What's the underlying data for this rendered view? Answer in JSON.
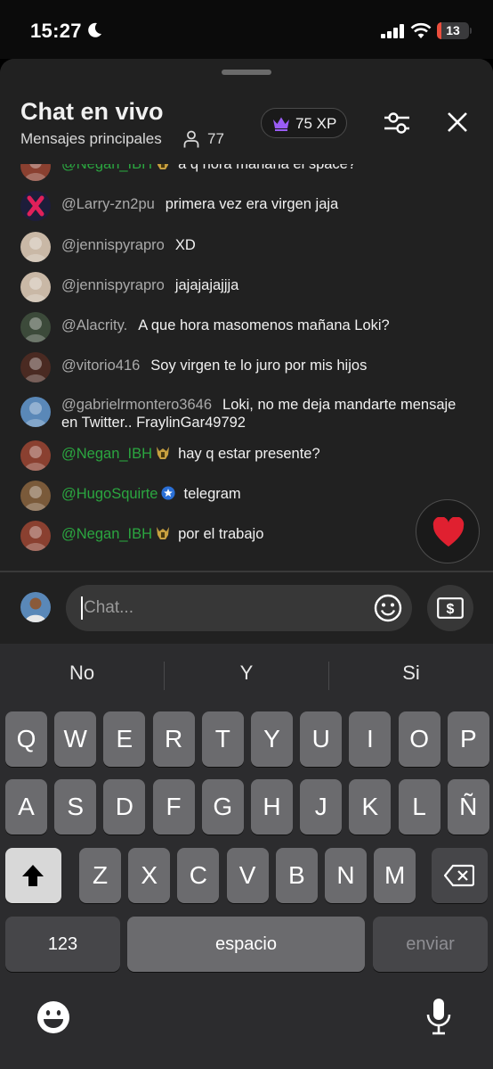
{
  "status_bar": {
    "time": "15:27",
    "battery": "13",
    "battery_level": 0.13,
    "icons": [
      "moon-icon",
      "signal-icon",
      "wifi-icon",
      "battery-icon"
    ]
  },
  "chat": {
    "title": "Chat en vivo",
    "subtitle": "Mensajes principales",
    "viewers": "77",
    "xp": "75 XP",
    "messages": [
      {
        "author": "@Negan_IBH",
        "text": "a q hora mañana el space?",
        "member": true,
        "badge": "helmet",
        "avatar": "#8a4030"
      },
      {
        "author": "@Larry-zn2pu",
        "text": "primera vez era virgen jaja",
        "member": false,
        "badge": "",
        "avatar": "#1d1d3a"
      },
      {
        "author": "@jennispyrapro",
        "text": "XD",
        "member": false,
        "badge": "",
        "avatar": "#c9b8a6"
      },
      {
        "author": "@jennispyrapro",
        "text": "jajajajajjja",
        "member": false,
        "badge": "",
        "avatar": "#c9b8a6"
      },
      {
        "author": "@Alacrity.",
        "text": "A que hora masomenos mañana Loki?",
        "member": false,
        "badge": "",
        "avatar": "#3c4a3a"
      },
      {
        "author": "@vitorio416",
        "text": "Soy virgen te lo juro por mis hijos",
        "member": false,
        "badge": "",
        "avatar": "#4a2a22"
      },
      {
        "author": "@gabrielrmontero3646",
        "text": "Loki, no me deja mandarte mensaje en Twitter.. FraylinGar49792",
        "member": false,
        "badge": "",
        "avatar": "#5a88b8"
      },
      {
        "author": "@Negan_IBH",
        "text": "hay q estar presente?",
        "member": true,
        "badge": "helmet",
        "avatar": "#8a4030"
      },
      {
        "author": "@HugoSquirte",
        "text": "telegram",
        "member": true,
        "badge": "star",
        "avatar": "#7a5a3a"
      },
      {
        "author": "@Negan_IBH",
        "text": "por el trabajo",
        "member": true,
        "badge": "helmet",
        "avatar": "#8a4030"
      }
    ],
    "input_placeholder": "Chat...",
    "colors": {
      "member": "#2ba640",
      "author": "#aaaaaa",
      "panel": "#212121",
      "heart": "#e02030"
    }
  },
  "keyboard": {
    "suggestions": [
      "No",
      "Y",
      "Si"
    ],
    "rows": [
      [
        "Q",
        "W",
        "E",
        "R",
        "T",
        "Y",
        "U",
        "I",
        "O",
        "P"
      ],
      [
        "A",
        "S",
        "D",
        "F",
        "G",
        "H",
        "J",
        "K",
        "L",
        "Ñ"
      ],
      [
        "Z",
        "X",
        "C",
        "V",
        "B",
        "N",
        "M"
      ]
    ],
    "numbers": "123",
    "space": "espacio",
    "send": "enviar"
  }
}
